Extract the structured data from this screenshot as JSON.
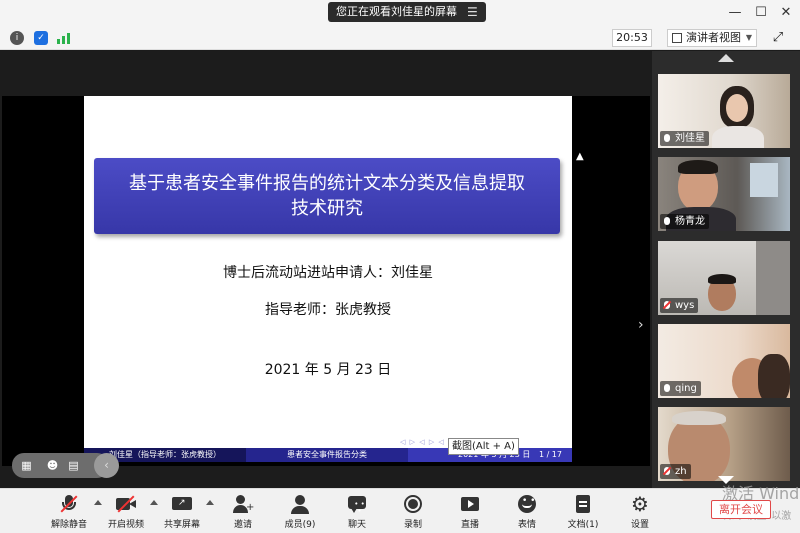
{
  "titlebar": {
    "share_banner": "您正在观看刘佳星的屏幕",
    "banner_menu_icon": "menu-icon",
    "window_controls": [
      "minimize-icon",
      "maximize-icon",
      "close-icon"
    ]
  },
  "toolbar": {
    "icons": [
      "info-icon",
      "shield-icon",
      "signal-icon"
    ],
    "clock": "20:53",
    "view_mode": "演讲者视图",
    "fullscreen_icon": "fullscreen-icon"
  },
  "slide": {
    "title_line1": "基于患者安全事件报告的统计文本分类及信息提取",
    "title_line2": "技术研究",
    "applicant": "博士后流动站进站申请人：刘佳星",
    "advisor": "指导老师：张虎教授",
    "date": "2021 年 5 月 23 日",
    "nav_symbols": "◁ ▷ ◁ ▷ ◁ ▷ ≡ ∽○",
    "footer": {
      "author": "刘佳星（指导老师：张虎教授）",
      "short_title": "患者安全事件报告分类",
      "date": "2021 年 5 月 23 日",
      "page": "1 / 17"
    }
  },
  "screenshot_tip": "截图(Alt + A)",
  "float_bar": {
    "icons": [
      "layout-icon",
      "emoji-icon",
      "chat-icon",
      "prev-icon"
    ]
  },
  "gallery": {
    "participants": [
      {
        "name": "刘佳星",
        "mic": "on"
      },
      {
        "name": "杨青龙",
        "mic": "on"
      },
      {
        "name": "wys",
        "mic": "muted"
      },
      {
        "name": "qing",
        "mic": "on"
      },
      {
        "name": "zh",
        "mic": "muted"
      }
    ]
  },
  "bottom_bar": {
    "buttons": [
      {
        "label": "解除静音",
        "icon": "mic-muted-icon"
      },
      {
        "label": "开启视频",
        "icon": "camera-off-icon"
      },
      {
        "label": "共享屏幕",
        "icon": "share-screen-icon"
      },
      {
        "label": "邀请",
        "icon": "invite-icon"
      },
      {
        "label": "成员(9)",
        "icon": "members-icon"
      },
      {
        "label": "聊天",
        "icon": "chat-icon"
      },
      {
        "label": "录制",
        "icon": "record-icon"
      },
      {
        "label": "直播",
        "icon": "live-icon"
      },
      {
        "label": "表情",
        "icon": "emoji-icon"
      },
      {
        "label": "文档(1)",
        "icon": "document-icon"
      },
      {
        "label": "设置",
        "icon": "settings-icon"
      }
    ],
    "leave": "离开会议"
  },
  "watermark": {
    "line1": "激活 Wind",
    "line2": "转到\"设置\"以激"
  },
  "colors": {
    "slide_title_bg": "#3c3cb0",
    "leave_red": "#e04848",
    "footer_dark": "#15155a"
  }
}
